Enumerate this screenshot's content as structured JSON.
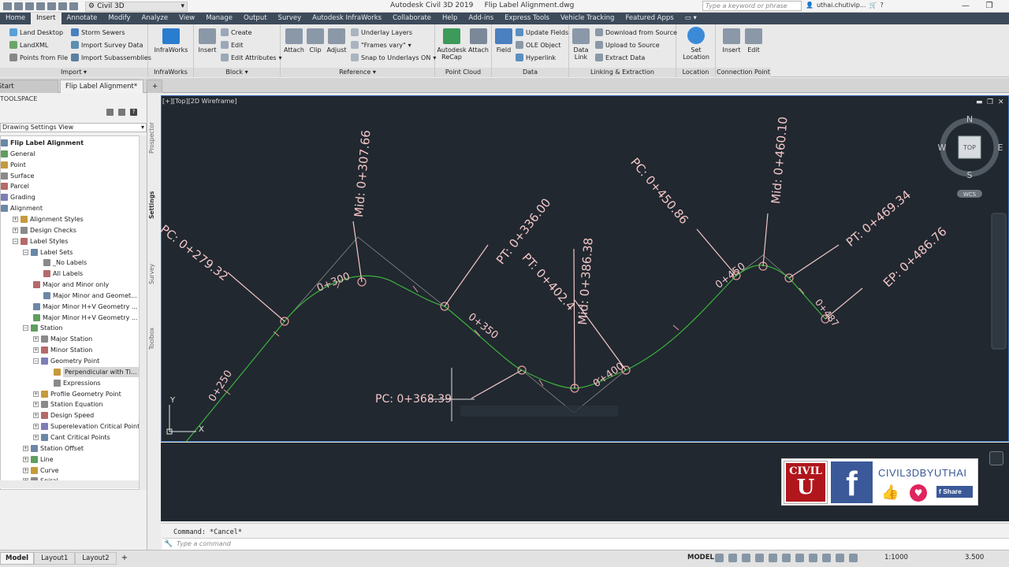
{
  "window": {
    "app_title": "Autodesk Civil 3D 2019",
    "file_title": "Flip Label Alignment.dwg",
    "workspace": "Civil 3D",
    "search_placeholder": "Type a keyword or phrase",
    "user": "uthai.chutivip...",
    "min": "—",
    "restore": "❐",
    "close": "✕"
  },
  "ribbon_tabs": [
    "Home",
    "Insert",
    "Annotate",
    "Modify",
    "Analyze",
    "View",
    "Manage",
    "Output",
    "Survey",
    "Autodesk InfraWorks",
    "Collaborate",
    "Help",
    "Add-ins",
    "Express Tools",
    "Vehicle Tracking",
    "Featured Apps"
  ],
  "ribbon": {
    "import": {
      "label": "Import",
      "items": [
        "Land Desktop",
        "LandXML",
        "Points from File",
        "Storm Sewers",
        "Import Survey Data",
        "Import Subassemblies"
      ]
    },
    "infraworks": {
      "label": "InfraWorks",
      "button": "InfraWorks"
    },
    "block": {
      "label": "Block",
      "insert": "Insert",
      "items": [
        "Create",
        "Edit",
        "Edit Attributes"
      ]
    },
    "reference": {
      "label": "Reference",
      "buttons": [
        "Attach",
        "Clip",
        "Adjust"
      ],
      "items": [
        "Underlay Layers",
        "\"Frames vary\"",
        "Snap to Underlays ON"
      ]
    },
    "point_cloud": {
      "label": "Point Cloud",
      "buttons": [
        "Autodesk ReCap",
        "Attach"
      ]
    },
    "data": {
      "label": "Data",
      "field": "Field",
      "items": [
        "Update Fields",
        "OLE Object",
        "Hyperlink"
      ]
    },
    "linking": {
      "label": "Linking & Extraction",
      "data_link": "Data Link",
      "items": [
        "Download from Source",
        "Upload to Source",
        "Extract  Data"
      ]
    },
    "location": {
      "label": "Location",
      "button": "Set Location"
    },
    "connection": {
      "label": "Connection Point",
      "buttons": [
        "Insert",
        "Edit"
      ]
    }
  },
  "file_tabs": [
    "Start",
    "Flip Label Alignment*",
    "+"
  ],
  "toolspace": {
    "header": "TOOLSPACE",
    "view": "Drawing Settings View",
    "side_tabs": [
      "Prospector",
      "Settings",
      "Survey",
      "Toolbox"
    ],
    "tree": [
      {
        "label": "Flip Label Alignment",
        "level": 0,
        "bold": true
      },
      {
        "label": "General",
        "level": 0
      },
      {
        "label": "Point",
        "level": 0
      },
      {
        "label": "Surface",
        "level": 0
      },
      {
        "label": "Parcel",
        "level": 0
      },
      {
        "label": "Grading",
        "level": 0
      },
      {
        "label": "Alignment",
        "level": 0
      },
      {
        "label": "Alignment Styles",
        "level": 1
      },
      {
        "label": "Design Checks",
        "level": 1
      },
      {
        "label": "Label Styles",
        "level": 1
      },
      {
        "label": "Label Sets",
        "level": 2
      },
      {
        "label": "_No Labels",
        "level": 4
      },
      {
        "label": "All Labels",
        "level": 4
      },
      {
        "label": "Major and Minor only",
        "level": 3
      },
      {
        "label": "Major Minor and Geomet...",
        "level": 4
      },
      {
        "label": "Major Minor H+V Geometry ...",
        "level": 3
      },
      {
        "label": "Major Minor H+V Geometry ...",
        "level": 3
      },
      {
        "label": "Station",
        "level": 2
      },
      {
        "label": "Major Station",
        "level": 3
      },
      {
        "label": "Minor Station",
        "level": 3
      },
      {
        "label": "Geometry Point",
        "level": 3
      },
      {
        "label": "Perpendicular with Ti...",
        "level": 5,
        "selected": true
      },
      {
        "label": "Expressions",
        "level": 5
      },
      {
        "label": "Profile Geometry Point",
        "level": 3
      },
      {
        "label": "Station Equation",
        "level": 3
      },
      {
        "label": "Design Speed",
        "level": 3
      },
      {
        "label": "Superelevation Critical Points",
        "level": 3
      },
      {
        "label": "Cant Critical Points",
        "level": 3
      },
      {
        "label": "Station Offset",
        "level": 2
      },
      {
        "label": "Line",
        "level": 2
      },
      {
        "label": "Curve",
        "level": 2
      },
      {
        "label": "Spiral",
        "level": 2
      }
    ]
  },
  "viewport": {
    "label": "[+][Top][2D Wireframe]",
    "viewcube": {
      "n": "N",
      "s": "S",
      "e": "E",
      "w": "W",
      "top": "TOP",
      "wcs": "WCS"
    },
    "ucs": {
      "x": "X",
      "y": "Y"
    },
    "station_labels": [
      "0+250",
      "0+300",
      "0+350",
      "0+400",
      "0+450",
      "0+487"
    ],
    "geometry_labels": [
      "PC: 0+279.32",
      "Mid: 0+307.66",
      "PT: 0+336.00",
      "PT: 0+402.4",
      "Mid: 0+386.38",
      "PC: 0+450.86",
      "Mid: 0+460.10",
      "PT: 0+469.34",
      "EP: 0+486.76"
    ],
    "dragging_label": "PC:  0+368.39",
    "colors": {
      "alignment": "#3bb33b",
      "label": "#f2c6c6",
      "ticks": "#e3a0a0",
      "bg": "#212830"
    }
  },
  "brand": {
    "name": "CIVIL3DBYUTHAI",
    "logo_text": "CIVIL",
    "share": "Share"
  },
  "command": {
    "history": "Command: *Cancel*",
    "placeholder": "Type a command"
  },
  "status": {
    "layout_tabs": [
      "Model",
      "Layout1",
      "Layout2"
    ],
    "model": "MODEL",
    "scale": "1:1000",
    "value": "3.500"
  }
}
